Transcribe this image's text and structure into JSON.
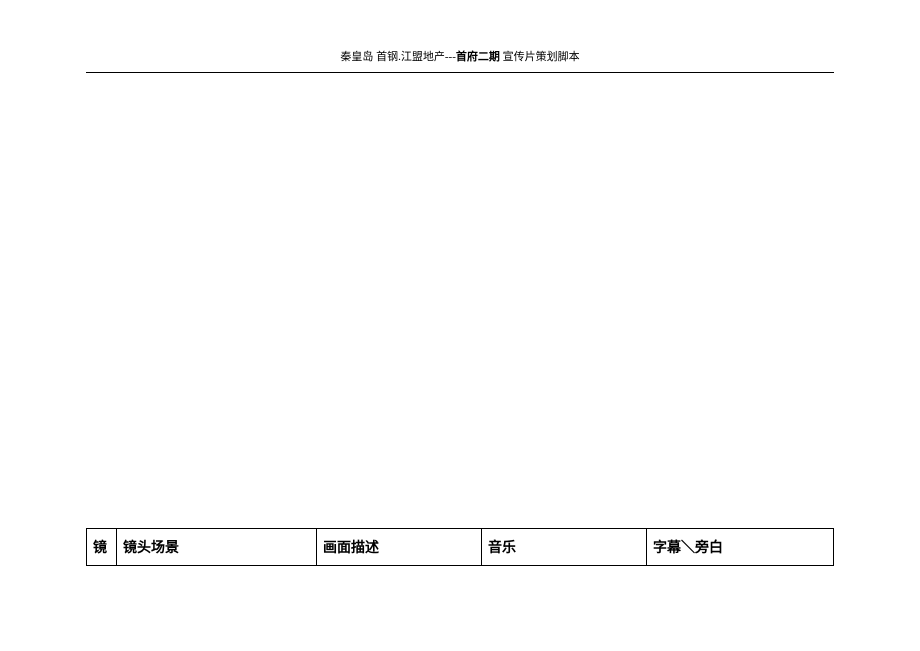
{
  "header": {
    "part1": "秦皇岛  首钢.江盟地产---",
    "bold": "首府二期",
    "part2": "  宣传片策划脚本"
  },
  "table": {
    "headers": {
      "col1": "镜",
      "col2": "镜头场景",
      "col3": "画面描述",
      "col4": "音乐",
      "col5": "字幕＼旁白"
    }
  }
}
